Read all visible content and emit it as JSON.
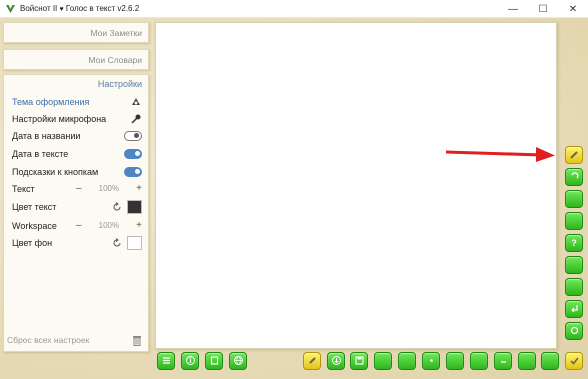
{
  "window": {
    "title_app": "Войснот II",
    "title_heart": "♥",
    "title_rest": "Голос в текст v2.6.2",
    "minimize": "—",
    "maximize": "☐",
    "close": "✕"
  },
  "sidebar": {
    "notes_tab": "Мои Заметки",
    "dictionaries_tab": "Мои Словари",
    "settings_title": "Настройки",
    "theme_label": "Тема оформления",
    "mic_label": "Настройки микрофона",
    "date_in_name_label": "Дата в названии",
    "date_in_name_on": false,
    "date_in_text_label": "Дата в тексте",
    "date_in_text_on": true,
    "hints_label": "Подсказки к кнопкам",
    "hints_on": true,
    "text_size_label": "Текст",
    "text_size_value": "100%",
    "text_color_label": "Цвет текст",
    "text_color": "#333333",
    "workspace_label": "Workspace",
    "workspace_value": "100%",
    "bg_color_label": "Цвет фон",
    "bg_color": "#ffffff",
    "minus": "–",
    "plus": "+",
    "reset_all": "Сброс всех настроек"
  },
  "colors": {
    "accent_blue": "#4c86c4",
    "button_green": "#3cc628",
    "button_yellow": "#f2d836",
    "arrow_red": "#e02020"
  },
  "icons": {
    "right_toolbar": [
      "pen-icon",
      "undo-icon",
      "blank-icon",
      "blank-icon",
      "question-icon",
      "blank-icon",
      "blank-icon",
      "enter-icon",
      "refresh-icon",
      "check-icon"
    ],
    "bottom_left": [
      "list-icon",
      "info-icon",
      "book-icon",
      "globe-icon"
    ],
    "bottom_right": [
      "brush-icon",
      "download-icon",
      "save-icon",
      "blank-icon",
      "blank-icon",
      "dot-icon",
      "blank-icon",
      "blank-icon",
      "dash-icon",
      "blank-icon",
      "blank-icon"
    ]
  }
}
